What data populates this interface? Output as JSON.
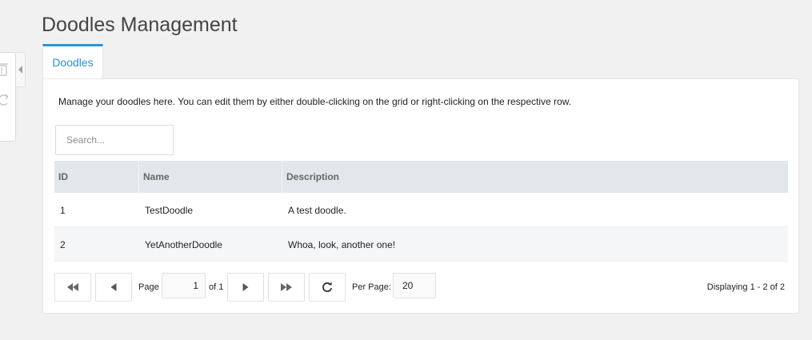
{
  "page_title": "Doodles Management",
  "tab_label": "Doodles",
  "intro_text": "Manage your doodles here. You can edit them by either double-clicking on the grid or right-clicking on the respective row.",
  "search": {
    "placeholder": "Search...",
    "value": ""
  },
  "grid": {
    "columns": [
      "ID",
      "Name",
      "Description"
    ],
    "rows": [
      {
        "id": "1",
        "name": "TestDoodle",
        "description": "A test doodle."
      },
      {
        "id": "2",
        "name": "YetAnotherDoodle",
        "description": "Whoa, look, another one!"
      }
    ]
  },
  "pager": {
    "page_label": "Page",
    "current_page": "1",
    "of_label": "of 1",
    "per_page_label": "Per Page:",
    "per_page": "20",
    "display_text": "Displaying 1 - 2 of 2"
  },
  "icons": {
    "side_toolbar": [
      "trash-icon",
      "refresh-icon"
    ],
    "pager": [
      "first-page-icon",
      "prev-page-icon",
      "next-page-icon",
      "last-page-icon",
      "refresh-icon"
    ]
  },
  "colors": {
    "accent": "#2597d3",
    "background": "#f1f1f1",
    "grid_header": "#e3e6ea",
    "alt_row": "#f5f6f8"
  }
}
